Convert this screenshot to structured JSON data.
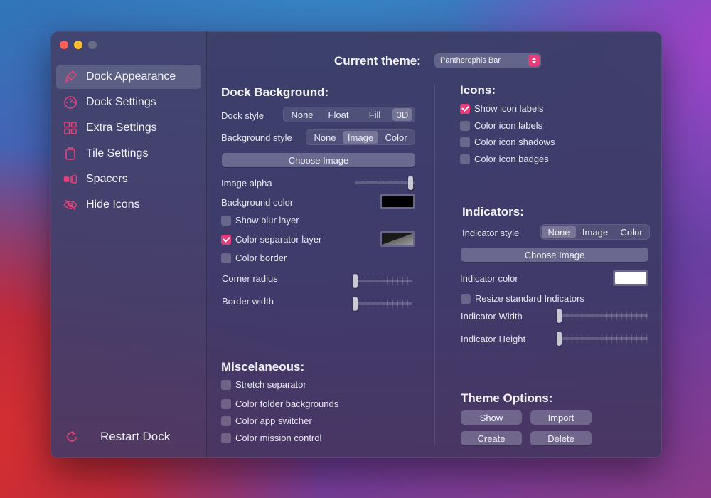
{
  "sidebar": {
    "items": [
      {
        "label": "Dock Appearance",
        "icon": "brush-icon"
      },
      {
        "label": "Dock Settings",
        "icon": "gauge-icon"
      },
      {
        "label": "Extra Settings",
        "icon": "grid-icon"
      },
      {
        "label": "Tile Settings",
        "icon": "tile-icon"
      },
      {
        "label": "Spacers",
        "icon": "spacer-icon"
      },
      {
        "label": "Hide Icons",
        "icon": "eye-slash-icon"
      }
    ],
    "restart_label": "Restart Dock"
  },
  "theme": {
    "label": "Current theme:",
    "value": "Pantherophis Bar"
  },
  "dock_background": {
    "title": "Dock Background:",
    "dock_style_label": "Dock style",
    "dock_style_options": [
      "None",
      "Float",
      "Fill",
      "3D"
    ],
    "dock_style_selected": "3D",
    "background_style_label": "Background style",
    "background_style_options": [
      "None",
      "Image",
      "Color"
    ],
    "background_style_selected": "Image",
    "choose_image": "Choose Image",
    "image_alpha_label": "Image alpha",
    "image_alpha_level": 0.97,
    "background_color_label": "Background color",
    "background_color": "#000000",
    "show_blur_layer": "Show blur layer",
    "color_separator_layer": "Color separator layer",
    "color_border": "Color border",
    "corner_radius_label": "Corner radius",
    "corner_radius_level": 0.0,
    "border_width_label": "Border width",
    "border_width_level": 0.0
  },
  "misc": {
    "title": "Miscelaneous:",
    "items": [
      "Stretch separator",
      "Color folder backgrounds",
      "Color app switcher",
      "Color mission control"
    ]
  },
  "icons": {
    "title": "Icons:",
    "items": [
      "Show icon labels",
      "Color icon labels",
      "Color icon shadows",
      "Color icon badges"
    ],
    "checked": [
      true,
      false,
      false,
      false
    ]
  },
  "indicators": {
    "title": "Indicators:",
    "style_label": "Indicator style",
    "style_options": [
      "None",
      "Image",
      "Color"
    ],
    "style_selected": "None",
    "choose_image": "Choose Image",
    "color_label": "Indicator color",
    "color": "#ffffff",
    "resize_label": "Resize standard Indicators",
    "width_label": "Indicator Width",
    "width_level": 0.0,
    "height_label": "Indicator Height",
    "height_level": 0.0
  },
  "theme_options": {
    "title": "Theme Options:",
    "show": "Show",
    "import": "Import",
    "create": "Create",
    "delete": "Delete"
  },
  "colors": {
    "accent": "#e33e7a"
  }
}
